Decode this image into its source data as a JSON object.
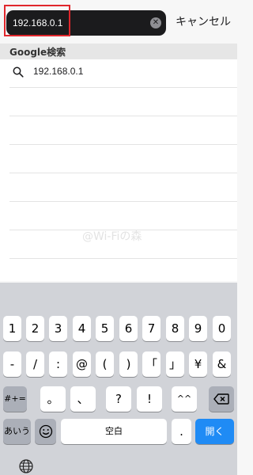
{
  "search": {
    "query": "192.168.0.1",
    "clear_icon": "clear-icon",
    "cancel_label": "キャンセル"
  },
  "suggestions": {
    "section_label": "Google検索",
    "items": [
      {
        "icon": "search-icon",
        "text": "192.168.0.1"
      }
    ]
  },
  "watermark": "@Wi-Fiの森",
  "keyboard": {
    "row1": [
      "1",
      "2",
      "3",
      "4",
      "5",
      "6",
      "7",
      "8",
      "9",
      "0"
    ],
    "row2": [
      "-",
      "/",
      ":",
      "@",
      "(",
      ")",
      "「",
      "」",
      "¥",
      "&"
    ],
    "row3": {
      "left": "#+=",
      "keys": [
        "。",
        "、",
        "?",
        "!",
        "^^"
      ],
      "delete_icon": "backspace-icon"
    },
    "row4": {
      "kana": "あいう",
      "emoji_icon": "emoji-icon",
      "space": "空白",
      "dot": ".",
      "enter": "開く"
    },
    "globe_icon": "globe-icon"
  },
  "colors": {
    "highlight": "#e0262c",
    "enter_key": "#1f8bf5",
    "search_field": "#1b1b1d"
  }
}
